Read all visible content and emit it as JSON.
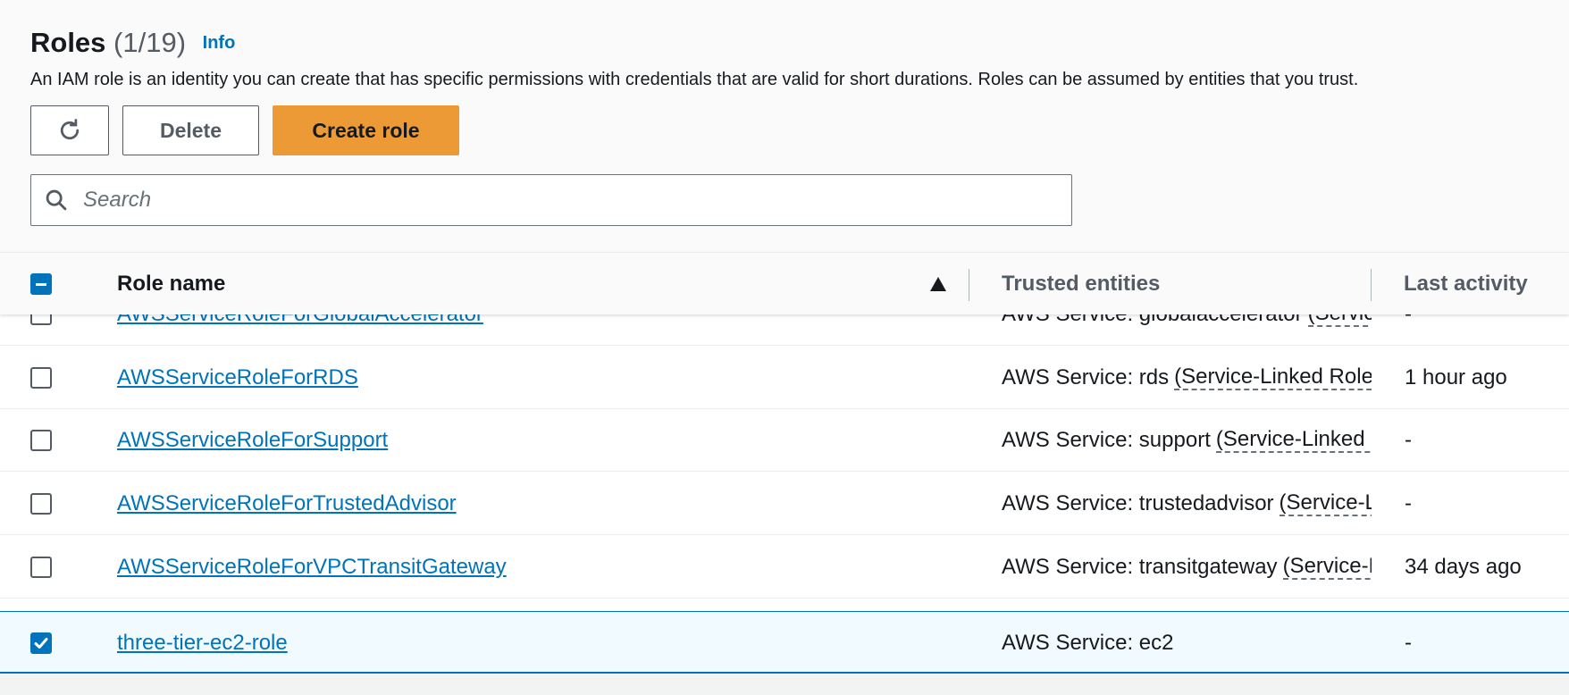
{
  "header": {
    "title": "Roles",
    "count": "(1/19)",
    "info_link": "Info",
    "description": "An IAM role is an identity you can create that has specific permissions with credentials that are valid for short durations. Roles can be assumed by entities that you trust."
  },
  "toolbar": {
    "refresh_icon": "refresh-icon",
    "delete_label": "Delete",
    "create_label": "Create role"
  },
  "search": {
    "placeholder": "Search",
    "value": ""
  },
  "table": {
    "columns": {
      "role_name": "Role name",
      "trusted_entities": "Trusted entities",
      "last_activity": "Last activity"
    },
    "sort": {
      "column": "Role name",
      "direction": "ascending"
    },
    "rows": [
      {
        "name": "AWSServiceRoleForGlobalAccelerator",
        "trusted_prefix": "AWS Service: globalaccelerator",
        "trusted_link": "(Service-Linked Role)",
        "last_activity": "-",
        "selected": false
      },
      {
        "name": "AWSServiceRoleForRDS",
        "trusted_prefix": "AWS Service: rds",
        "trusted_link": "(Service-Linked Role)",
        "last_activity": "1 hour ago",
        "selected": false
      },
      {
        "name": "AWSServiceRoleForSupport",
        "trusted_prefix": "AWS Service: support",
        "trusted_link": "(Service-Linked Role)",
        "last_activity": "-",
        "selected": false
      },
      {
        "name": "AWSServiceRoleForTrustedAdvisor",
        "trusted_prefix": "AWS Service: trustedadvisor",
        "trusted_link": "(Service-Linked Role)",
        "last_activity": "-",
        "selected": false
      },
      {
        "name": "AWSServiceRoleForVPCTransitGateway",
        "trusted_prefix": "AWS Service: transitgateway",
        "trusted_link": "(Service-Linked Role)",
        "last_activity": "34 days ago",
        "selected": false
      },
      {
        "name": "three-tier-ec2-role",
        "trusted_prefix": "AWS Service: ec2",
        "trusted_link": "",
        "last_activity": "-",
        "selected": true
      }
    ]
  },
  "colors": {
    "link": "#0073bb",
    "primary_button": "#ec9a36",
    "selected_row_bg": "#f1faff",
    "text": "#16191f"
  }
}
